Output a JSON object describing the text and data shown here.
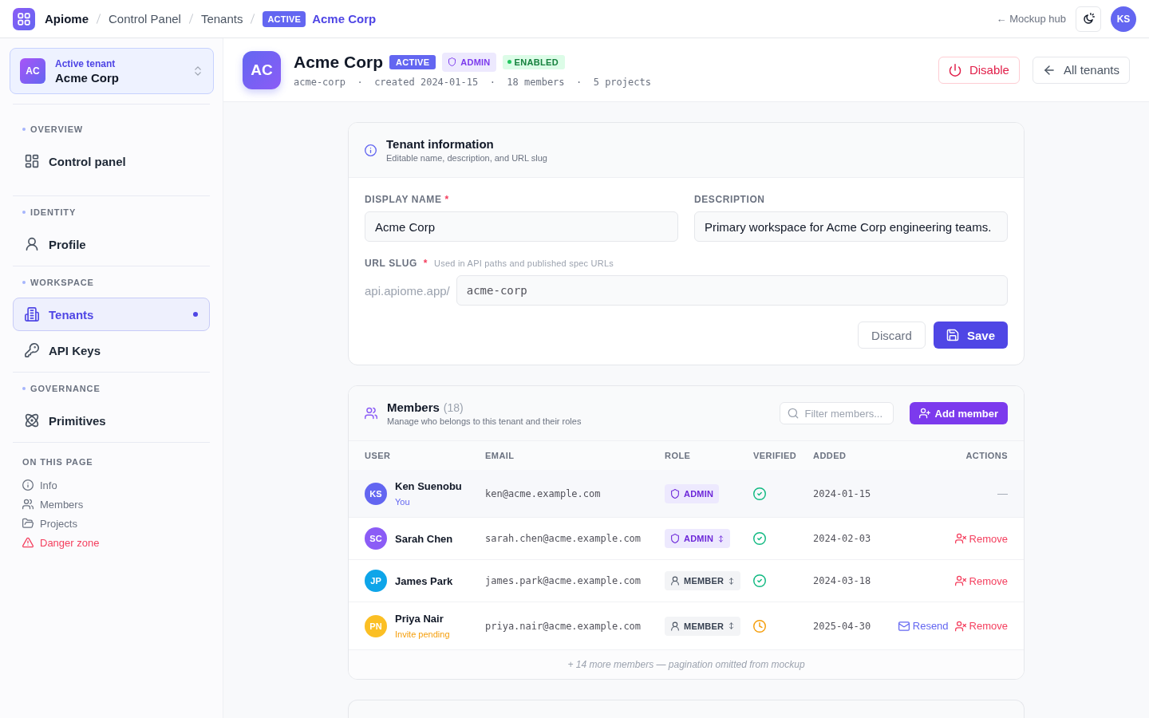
{
  "top_bar": {
    "app_name": "Apiome",
    "breadcrumb": [
      {
        "label": "Control Panel",
        "current": false
      },
      {
        "label": "Tenants",
        "current": false
      },
      {
        "label": "Acme Corp",
        "badge": "ACTIVE",
        "current": true
      }
    ],
    "hub_link": "← Mockup hub",
    "user_initials": "KS"
  },
  "sidebar": {
    "tenant_switcher": {
      "initials": "AC",
      "caption": "Active tenant",
      "name": "Acme Corp"
    },
    "sections": [
      {
        "label": "OVERVIEW",
        "items": [
          {
            "label": "Control panel",
            "selected": false
          }
        ]
      },
      {
        "label": "IDENTITY",
        "items": [
          {
            "label": "Profile",
            "selected": false
          }
        ]
      },
      {
        "label": "WORKSPACE",
        "items": [
          {
            "label": "Tenants",
            "selected": true
          },
          {
            "label": "API Keys",
            "selected": false
          }
        ]
      },
      {
        "label": "GOVERNANCE",
        "items": [
          {
            "label": "Primitives",
            "selected": false
          }
        ]
      }
    ],
    "on_this_page": {
      "label": "ON THIS PAGE",
      "items": [
        {
          "label": "Info",
          "kind": "link"
        },
        {
          "label": "Members",
          "kind": "link"
        },
        {
          "label": "Projects",
          "kind": "link"
        },
        {
          "label": "Danger zone",
          "kind": "danger"
        }
      ]
    }
  },
  "tenant_header": {
    "initials": "AC",
    "name": "Acme Corp",
    "badges": [
      {
        "label": "ACTIVE",
        "kind": "status"
      },
      {
        "label": "ADMIN",
        "kind": "role"
      },
      {
        "label": "ENABLED",
        "kind": "enabled"
      }
    ],
    "meta": "acme-corp  ·  created 2024-01-15  ·  18 members  ·  5 projects",
    "actions": [
      {
        "label": "Disable",
        "kind": "danger"
      },
      {
        "label": "All tenants",
        "kind": "back"
      }
    ]
  },
  "info_card": {
    "title": "Tenant information",
    "subtitle": "Editable name, description, and URL slug",
    "fields": [
      {
        "label": "DISPLAY NAME",
        "required_mark": "*",
        "value": "Acme Corp"
      },
      {
        "label": "DESCRIPTION",
        "value": "Primary workspace for Acme Corp engineering teams."
      }
    ],
    "slug": {
      "label": "URL SLUG",
      "required_mark": "*",
      "hint": "Used in API paths and published spec URLs",
      "prefix": "api.apiome.app/",
      "value": "acme-corp"
    },
    "buttons": [
      {
        "label": "Discard",
        "kind": "secondary"
      },
      {
        "label": "Save",
        "kind": "primary"
      }
    ]
  },
  "members": {
    "title": "Members",
    "count": "(18)",
    "subtitle": "Manage who belongs to this tenant and their roles",
    "filter": {
      "placeholder": "Filter members..."
    },
    "add_button": "Add member",
    "columns": [
      "USER",
      "EMAIL",
      "ROLE",
      "VERIFIED",
      "ADDED",
      "ACTIONS"
    ],
    "rows": [
      {
        "initials": "KS",
        "color": "#6366f1",
        "name": "Ken Suenobu",
        "note": {
          "text": "You",
          "kind": "self"
        },
        "email": "ken@acme.example.com",
        "role": {
          "label": "ADMIN",
          "kind": "admin",
          "editable": false
        },
        "verified": true,
        "added": "2024-01-15",
        "actions": [
          {
            "kind": "none",
            "label": "—"
          }
        ]
      },
      {
        "initials": "SC",
        "color": "#8b5cf6",
        "name": "Sarah Chen",
        "email": "sarah.chen@acme.example.com",
        "role": {
          "label": "ADMIN",
          "kind": "admin",
          "editable": true
        },
        "verified": true,
        "added": "2024-02-03",
        "actions": [
          {
            "kind": "remove",
            "label": "Remove"
          }
        ]
      },
      {
        "initials": "JP",
        "color": "#0ea5e9",
        "name": "James Park",
        "email": "james.park@acme.example.com",
        "role": {
          "label": "MEMBER",
          "kind": "member",
          "editable": true
        },
        "verified": true,
        "added": "2024-03-18",
        "actions": [
          {
            "kind": "remove",
            "label": "Remove"
          }
        ]
      },
      {
        "initials": "PN",
        "color": "#fbbf24",
        "name": "Priya Nair",
        "note": {
          "text": "Invite pending",
          "kind": "pending"
        },
        "email": "priya.nair@acme.example.com",
        "role": {
          "label": "MEMBER",
          "kind": "member",
          "editable": true
        },
        "verified": false,
        "added": "2025-04-30",
        "actions": [
          {
            "kind": "resend",
            "label": "Resend"
          },
          {
            "kind": "remove",
            "label": "Remove"
          }
        ]
      }
    ],
    "footer": "+ 14 more members — pagination omitted from mockup"
  }
}
